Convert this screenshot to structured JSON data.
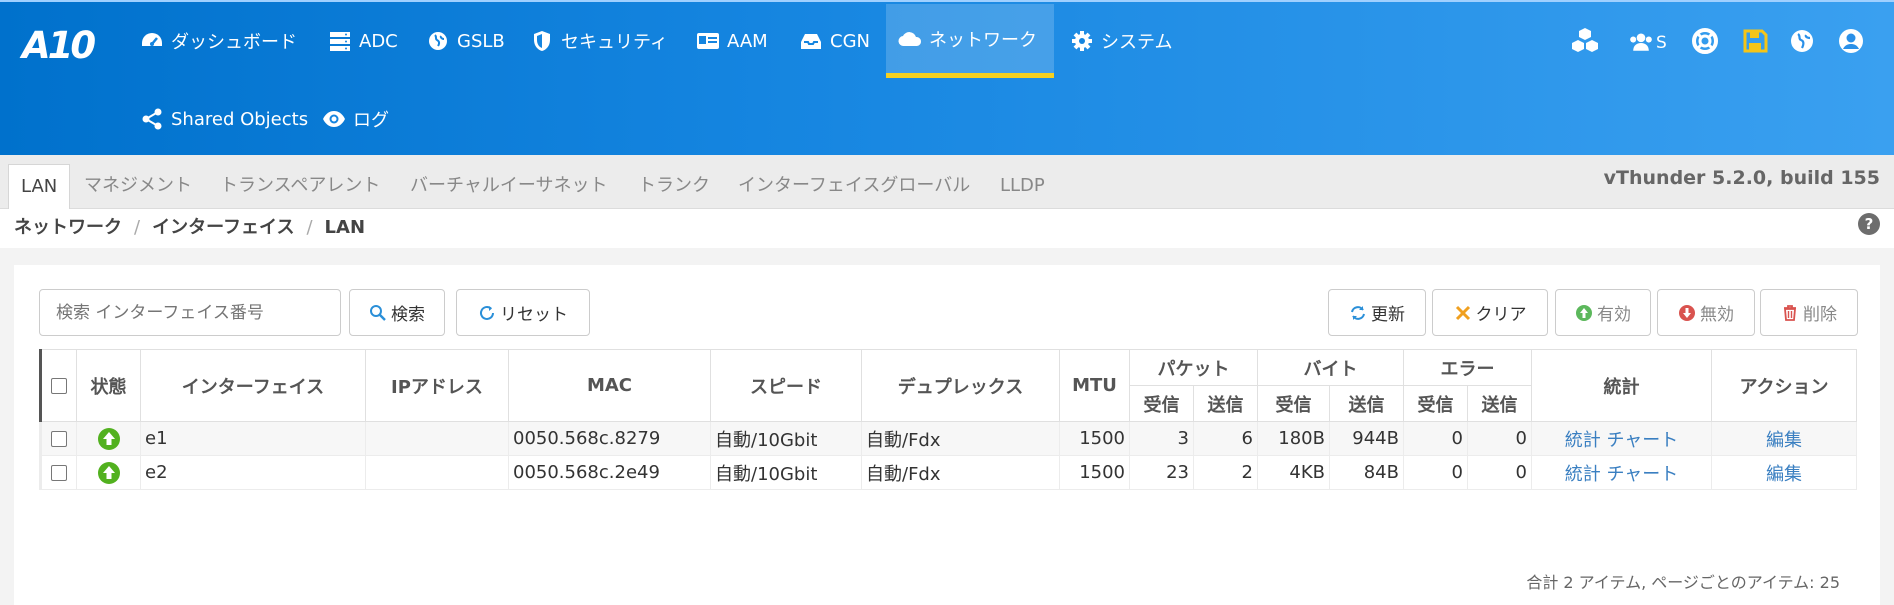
{
  "header": {
    "logo": "A10",
    "nav": [
      {
        "label": "ダッシュボード",
        "icon": "dashboard-icon"
      },
      {
        "label": "ADC",
        "icon": "server-icon"
      },
      {
        "label": "GSLB",
        "icon": "globe-icon"
      },
      {
        "label": "セキュリティ",
        "icon": "shield-icon"
      },
      {
        "label": "AAM",
        "icon": "id-card-icon"
      },
      {
        "label": "CGN",
        "icon": "inbox-icon"
      },
      {
        "label": "ネットワーク",
        "icon": "cloud-icon",
        "active": true
      },
      {
        "label": "システム",
        "icon": "gear-icon"
      }
    ],
    "nav2": [
      {
        "label": "Shared Objects",
        "icon": "share-icon"
      },
      {
        "label": "ログ",
        "icon": "eye-icon"
      }
    ],
    "right_icons": {
      "partition_icon": "cubes-icon",
      "users_label": "S",
      "help_icon": "lifebuoy-icon",
      "save_icon": "save-icon",
      "lang_icon": "globe-icon",
      "user_icon": "user-circle-icon"
    },
    "colors": {
      "accent": "#f5d020",
      "header": "#1585e0",
      "save": "#f5c518"
    }
  },
  "subtabs": [
    "LAN",
    "マネジメント",
    "トランスペアレント",
    "バーチャルイーサネット",
    "トランク",
    "インターフェイスグローバル",
    "LLDP"
  ],
  "version": "vThunder 5.2.0, build 155",
  "breadcrumb": [
    "ネットワーク",
    "インターフェイス",
    "LAN"
  ],
  "toolbar": {
    "search_placeholder": "検索 インターフェイス番号",
    "search": "検索",
    "reset": "リセット",
    "refresh": "更新",
    "clear": "クリア",
    "enable": "有効",
    "disable": "無効",
    "delete": "削除"
  },
  "table": {
    "headers": {
      "status": "状態",
      "interface": "インターフェイス",
      "ip": "IPアドレス",
      "mac": "MAC",
      "speed": "スピード",
      "duplex": "デュプレックス",
      "mtu": "MTU",
      "packets": "パケット",
      "bytes": "バイト",
      "errors": "エラー",
      "rx": "受信",
      "tx": "送信",
      "stats": "統計",
      "action": "アクション"
    },
    "rows": [
      {
        "name": "e1",
        "ip": "",
        "mac": "0050.568c.8279",
        "speed": "自動/10Gbit",
        "duplex": "自動/Fdx",
        "mtu": "1500",
        "pkt_rx": "3",
        "pkt_tx": "6",
        "byte_rx": "180B",
        "byte_tx": "944B",
        "err_rx": "0",
        "err_tx": "0",
        "stats": "統計 チャート",
        "action": "編集"
      },
      {
        "name": "e2",
        "ip": "",
        "mac": "0050.568c.2e49",
        "speed": "自動/10Gbit",
        "duplex": "自動/Fdx",
        "mtu": "1500",
        "pkt_rx": "23",
        "pkt_tx": "2",
        "byte_rx": "4KB",
        "byte_tx": "84B",
        "err_rx": "0",
        "err_tx": "0",
        "stats": "統計 チャート",
        "action": "編集"
      }
    ]
  },
  "footer": "合計 2 アイテム,  ページごとのアイテム: 25"
}
